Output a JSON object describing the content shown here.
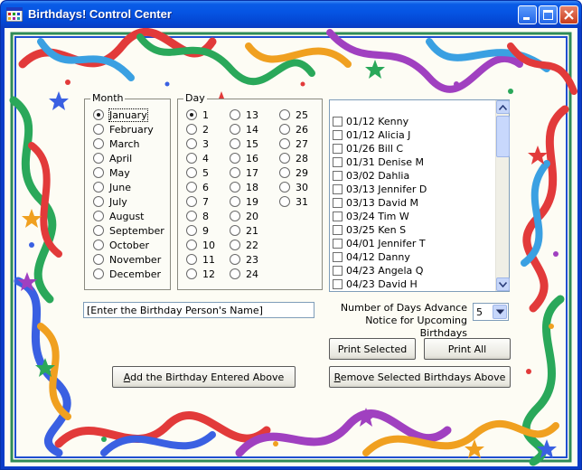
{
  "window": {
    "title": "Birthdays! Control Center"
  },
  "month_group": {
    "legend": "Month",
    "selected_index": 0,
    "items": [
      "January",
      "February",
      "March",
      "April",
      "May",
      "June",
      "July",
      "August",
      "September",
      "October",
      "November",
      "December"
    ]
  },
  "day_group": {
    "legend": "Day",
    "selected_index": 0,
    "items": [
      "1",
      "2",
      "3",
      "4",
      "5",
      "6",
      "7",
      "8",
      "9",
      "10",
      "11",
      "12",
      "13",
      "14",
      "15",
      "16",
      "17",
      "18",
      "19",
      "20",
      "21",
      "22",
      "23",
      "24",
      "25",
      "26",
      "27",
      "28",
      "29",
      "30",
      "31"
    ]
  },
  "birthday_list": {
    "items": [
      "01/12 Kenny",
      "01/12 Alicia J",
      "01/26 Bill C",
      "01/31 Denise M",
      "03/02 Dahlia",
      "03/13 Jennifer D",
      "03/13 David  M",
      "03/24 Tim W",
      "03/25 Ken S",
      "04/01 Jennifer T",
      "04/12 Danny",
      "04/23 Angela Q",
      "04/23 David H"
    ]
  },
  "name_input": {
    "value": "[Enter the Birthday Person's Name]"
  },
  "notice": {
    "label_line1": "Number of Days Advance",
    "label_line2": "Notice for Upcoming Birthdays",
    "value": "5"
  },
  "buttons": {
    "print_selected": "Print Selected",
    "print_all": "Print All",
    "add_prefix": "",
    "add_underlined": "A",
    "add_rest": "dd the Birthday Entered Above",
    "remove_prefix": "",
    "remove_underlined": "R",
    "remove_rest": "emove Selected Birthdays Above"
  },
  "colors": {
    "title_bar": "#0a5ce6",
    "background": "#fdfcf4"
  }
}
